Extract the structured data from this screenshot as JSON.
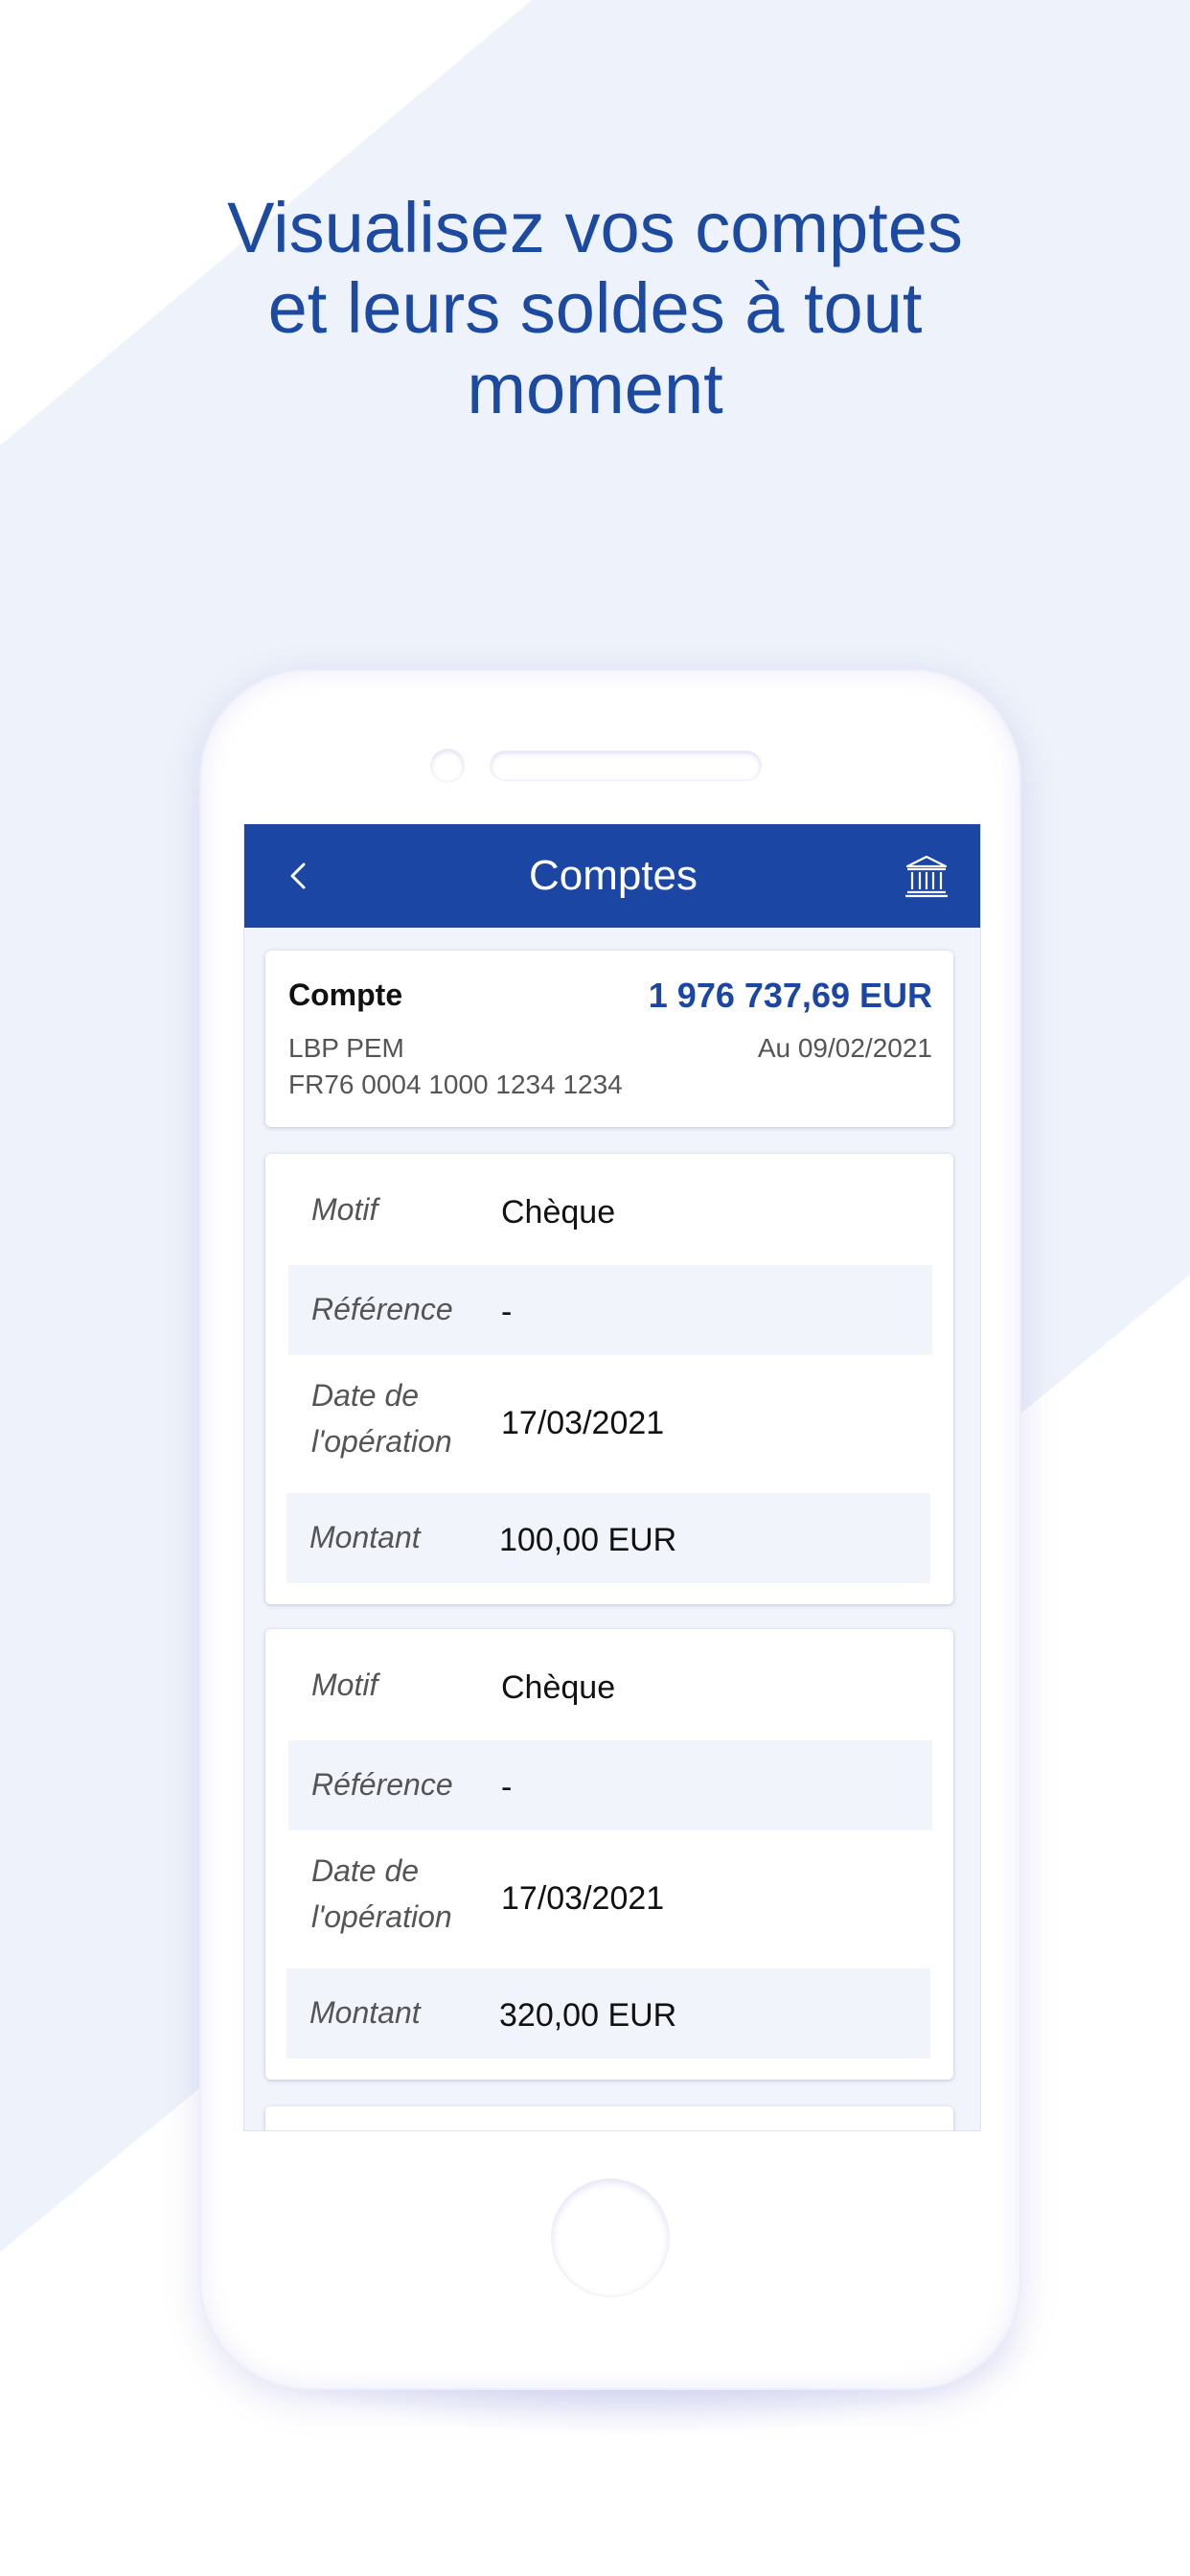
{
  "headline": {
    "line1": "Visualisez vos comptes",
    "line2": "et leurs soldes à tout",
    "line3": "moment"
  },
  "colors": {
    "brand_blue": "#1c46a3",
    "headline_blue": "#1c4aa0",
    "background_band": "#eef2fa",
    "row_shade": "#f1f4fa"
  },
  "navbar": {
    "back_icon": "chevron-left-icon",
    "title": "Comptes",
    "bank_icon": "bank-building-icon"
  },
  "account": {
    "label": "Compte",
    "balance": "1 976 737,69 EUR",
    "name": "LBP PEM",
    "date": "Au 09/02/2021",
    "iban": "FR76 0004 1000 1234 1234"
  },
  "operations": [
    {
      "motif_label": "Motif",
      "motif_value": "Chèque",
      "reference_label": "Référence",
      "reference_value": "-",
      "date_label_line1": "Date de",
      "date_label_line2": "l'opération",
      "date_value": "17/03/2021",
      "amount_label": "Montant",
      "amount_value": "100,00 EUR"
    },
    {
      "motif_label": "Motif",
      "motif_value": "Chèque",
      "reference_label": "Référence",
      "reference_value": "-",
      "date_label_line1": "Date de",
      "date_label_line2": "l'opération",
      "date_value": "17/03/2021",
      "amount_label": "Montant",
      "amount_value": "320,00 EUR"
    }
  ]
}
